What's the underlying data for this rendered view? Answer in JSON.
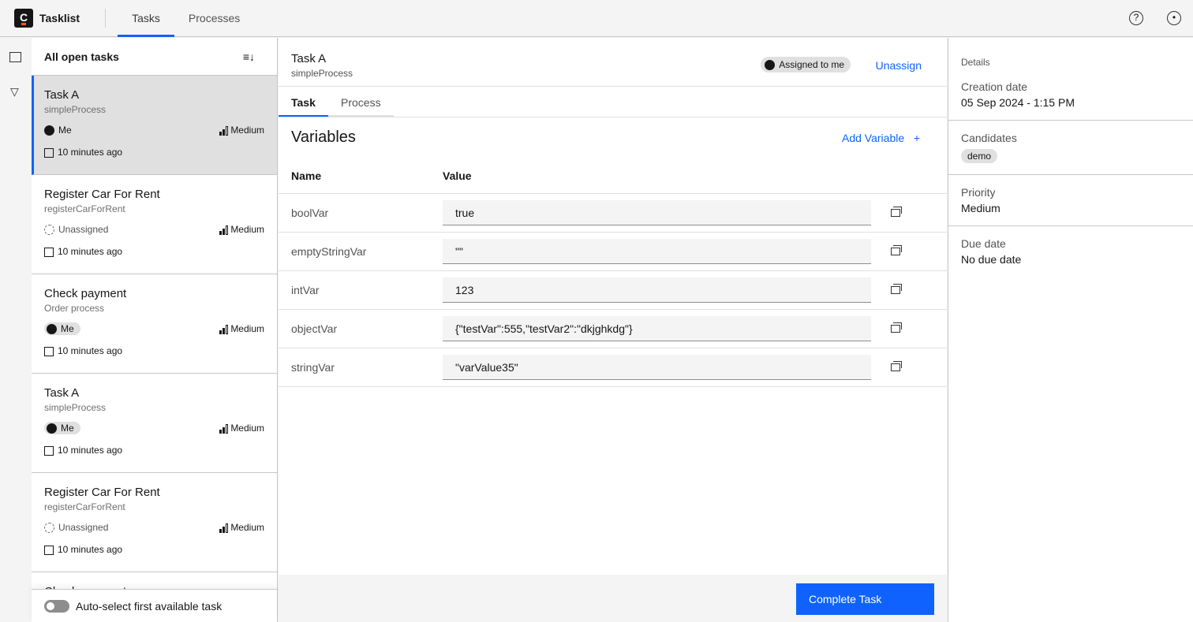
{
  "header": {
    "logo": "C",
    "brand": "Tasklist",
    "tabs": [
      "Tasks",
      "Processes"
    ]
  },
  "list": {
    "title": "All open tasks",
    "auto_select_label": "Auto-select first available task",
    "tasks": [
      {
        "name": "Task A",
        "process": "simpleProcess",
        "assignee": "Me",
        "priority": "Medium",
        "created": "10 minutes ago"
      },
      {
        "name": "Register Car For Rent",
        "process": "registerCarForRent",
        "assignee": "Unassigned",
        "priority": "Medium",
        "created": "10 minutes ago"
      },
      {
        "name": "Check payment",
        "process": "Order process",
        "assignee": "Me",
        "priority": "Medium",
        "created": "10 minutes ago"
      },
      {
        "name": "Task A",
        "process": "simpleProcess",
        "assignee": "Me",
        "priority": "Medium",
        "created": "10 minutes ago"
      },
      {
        "name": "Register Car For Rent",
        "process": "registerCarForRent",
        "assignee": "Unassigned",
        "priority": "Medium",
        "created": "10 minutes ago"
      },
      {
        "name": "Check payment"
      }
    ]
  },
  "task": {
    "name": "Task A",
    "process": "simpleProcess",
    "assigned_label": "Assigned to me",
    "unassign": "Unassign",
    "tabs": [
      "Task",
      "Process"
    ],
    "variables_title": "Variables",
    "add_variable": "Add Variable",
    "add_icon": "+",
    "columns": [
      "Name",
      "Value"
    ],
    "variables": [
      {
        "name": "boolVar",
        "value": "true"
      },
      {
        "name": "emptyStringVar",
        "value": "\"\""
      },
      {
        "name": "intVar",
        "value": "123"
      },
      {
        "name": "objectVar",
        "value": "{\"testVar\":555,\"testVar2\":\"dkjghkdg\"}"
      },
      {
        "name": "stringVar",
        "value": "\"varValue35\""
      }
    ],
    "complete": "Complete Task"
  },
  "details": {
    "title": "Details",
    "creation_label": "Creation date",
    "creation": "05 Sep 2024 - 1:15 PM",
    "candidates_label": "Candidates",
    "candidates": [
      "demo"
    ],
    "priority_label": "Priority",
    "priority": "Medium",
    "due_label": "Due date",
    "due": "No due date"
  },
  "colors": {
    "accent": "#0f62fe"
  }
}
